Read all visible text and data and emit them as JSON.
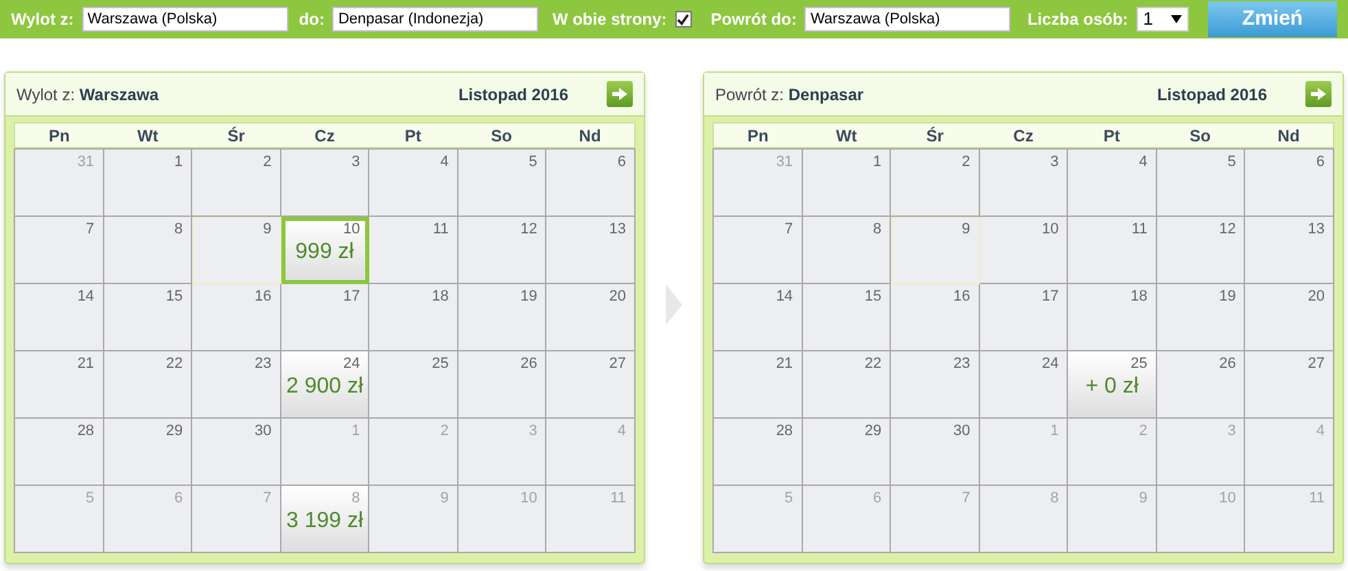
{
  "search_bar": {
    "from_label": "Wylot z:",
    "from_value": "Warszawa (Polska)",
    "to_label": "do:",
    "to_value": "Denpasar (Indonezja)",
    "round_trip_label": "W obie strony:",
    "round_trip_checked": true,
    "return_label": "Powrót do:",
    "return_value": "Warszawa (Polska)",
    "persons_label": "Liczba osób:",
    "persons_value": "1",
    "submit": "Zmień"
  },
  "calendars": [
    {
      "label": "Wylot z:",
      "city": "Warszawa",
      "month": "Listopad 2016",
      "weekdays": [
        "Pn",
        "Wt",
        "Śr",
        "Cz",
        "Pt",
        "So",
        "Nd"
      ],
      "weeks": [
        [
          {
            "day": "31",
            "other_month": true,
            "selected": false,
            "highlighted": false
          },
          {
            "day": "1",
            "other_month": false,
            "selected": false,
            "highlighted": false
          },
          {
            "day": "2",
            "other_month": false,
            "selected": false,
            "highlighted": false
          },
          {
            "day": "3",
            "other_month": false,
            "selected": false,
            "highlighted": false
          },
          {
            "day": "4",
            "other_month": false,
            "selected": false,
            "highlighted": false
          },
          {
            "day": "5",
            "other_month": false,
            "selected": false,
            "highlighted": false
          },
          {
            "day": "6",
            "other_month": false,
            "selected": false,
            "highlighted": false
          }
        ],
        [
          {
            "day": "7",
            "other_month": false,
            "selected": false,
            "highlighted": false
          },
          {
            "day": "8",
            "other_month": false,
            "selected": false,
            "highlighted": false
          },
          {
            "day": "9",
            "other_month": false,
            "selected": false,
            "highlighted": true
          },
          {
            "day": "10",
            "other_month": false,
            "selected": true,
            "highlighted": false,
            "price": "999 zł"
          },
          {
            "day": "11",
            "other_month": false,
            "selected": false,
            "highlighted": false
          },
          {
            "day": "12",
            "other_month": false,
            "selected": false,
            "highlighted": false
          },
          {
            "day": "13",
            "other_month": false,
            "selected": false,
            "highlighted": false
          }
        ],
        [
          {
            "day": "14",
            "other_month": false,
            "selected": false,
            "highlighted": false
          },
          {
            "day": "15",
            "other_month": false,
            "selected": false,
            "highlighted": false
          },
          {
            "day": "16",
            "other_month": false,
            "selected": false,
            "highlighted": false
          },
          {
            "day": "17",
            "other_month": false,
            "selected": false,
            "highlighted": false
          },
          {
            "day": "18",
            "other_month": false,
            "selected": false,
            "highlighted": false
          },
          {
            "day": "19",
            "other_month": false,
            "selected": false,
            "highlighted": false
          },
          {
            "day": "20",
            "other_month": false,
            "selected": false,
            "highlighted": false
          }
        ],
        [
          {
            "day": "21",
            "other_month": false,
            "selected": false,
            "highlighted": false
          },
          {
            "day": "22",
            "other_month": false,
            "selected": false,
            "highlighted": false
          },
          {
            "day": "23",
            "other_month": false,
            "selected": false,
            "highlighted": false
          },
          {
            "day": "24",
            "other_month": false,
            "selected": false,
            "highlighted": false,
            "price": "2 900 zł"
          },
          {
            "day": "25",
            "other_month": false,
            "selected": false,
            "highlighted": false
          },
          {
            "day": "26",
            "other_month": false,
            "selected": false,
            "highlighted": false
          },
          {
            "day": "27",
            "other_month": false,
            "selected": false,
            "highlighted": false
          }
        ],
        [
          {
            "day": "28",
            "other_month": false,
            "selected": false,
            "highlighted": false
          },
          {
            "day": "29",
            "other_month": false,
            "selected": false,
            "highlighted": false
          },
          {
            "day": "30",
            "other_month": false,
            "selected": false,
            "highlighted": false
          },
          {
            "day": "1",
            "other_month": true,
            "selected": false,
            "highlighted": false
          },
          {
            "day": "2",
            "other_month": true,
            "selected": false,
            "highlighted": false
          },
          {
            "day": "3",
            "other_month": true,
            "selected": false,
            "highlighted": false
          },
          {
            "day": "4",
            "other_month": true,
            "selected": false,
            "highlighted": false
          }
        ],
        [
          {
            "day": "5",
            "other_month": true,
            "selected": false,
            "highlighted": false
          },
          {
            "day": "6",
            "other_month": true,
            "selected": false,
            "highlighted": false
          },
          {
            "day": "7",
            "other_month": true,
            "selected": false,
            "highlighted": false
          },
          {
            "day": "8",
            "other_month": true,
            "selected": false,
            "highlighted": false,
            "price": "3 199 zł"
          },
          {
            "day": "9",
            "other_month": true,
            "selected": false,
            "highlighted": false
          },
          {
            "day": "10",
            "other_month": true,
            "selected": false,
            "highlighted": false
          },
          {
            "day": "11",
            "other_month": true,
            "selected": false,
            "highlighted": false
          }
        ]
      ]
    },
    {
      "label": "Powrót z:",
      "city": "Denpasar",
      "month": "Listopad 2016",
      "weekdays": [
        "Pn",
        "Wt",
        "Śr",
        "Cz",
        "Pt",
        "So",
        "Nd"
      ],
      "weeks": [
        [
          {
            "day": "31",
            "other_month": true,
            "selected": false,
            "highlighted": false
          },
          {
            "day": "1",
            "other_month": false,
            "selected": false,
            "highlighted": false
          },
          {
            "day": "2",
            "other_month": false,
            "selected": false,
            "highlighted": false
          },
          {
            "day": "3",
            "other_month": false,
            "selected": false,
            "highlighted": false
          },
          {
            "day": "4",
            "other_month": false,
            "selected": false,
            "highlighted": false
          },
          {
            "day": "5",
            "other_month": false,
            "selected": false,
            "highlighted": false
          },
          {
            "day": "6",
            "other_month": false,
            "selected": false,
            "highlighted": false
          }
        ],
        [
          {
            "day": "7",
            "other_month": false,
            "selected": false,
            "highlighted": false
          },
          {
            "day": "8",
            "other_month": false,
            "selected": false,
            "highlighted": false
          },
          {
            "day": "9",
            "other_month": false,
            "selected": false,
            "highlighted": true
          },
          {
            "day": "10",
            "other_month": false,
            "selected": false,
            "highlighted": false
          },
          {
            "day": "11",
            "other_month": false,
            "selected": false,
            "highlighted": false
          },
          {
            "day": "12",
            "other_month": false,
            "selected": false,
            "highlighted": false
          },
          {
            "day": "13",
            "other_month": false,
            "selected": false,
            "highlighted": false
          }
        ],
        [
          {
            "day": "14",
            "other_month": false,
            "selected": false,
            "highlighted": false
          },
          {
            "day": "15",
            "other_month": false,
            "selected": false,
            "highlighted": false
          },
          {
            "day": "16",
            "other_month": false,
            "selected": false,
            "highlighted": false
          },
          {
            "day": "17",
            "other_month": false,
            "selected": false,
            "highlighted": false
          },
          {
            "day": "18",
            "other_month": false,
            "selected": false,
            "highlighted": false
          },
          {
            "day": "19",
            "other_month": false,
            "selected": false,
            "highlighted": false
          },
          {
            "day": "20",
            "other_month": false,
            "selected": false,
            "highlighted": false
          }
        ],
        [
          {
            "day": "21",
            "other_month": false,
            "selected": false,
            "highlighted": false
          },
          {
            "day": "22",
            "other_month": false,
            "selected": false,
            "highlighted": false
          },
          {
            "day": "23",
            "other_month": false,
            "selected": false,
            "highlighted": false
          },
          {
            "day": "24",
            "other_month": false,
            "selected": false,
            "highlighted": false
          },
          {
            "day": "25",
            "other_month": false,
            "selected": false,
            "highlighted": false,
            "price": "+ 0 zł"
          },
          {
            "day": "26",
            "other_month": false,
            "selected": false,
            "highlighted": false
          },
          {
            "day": "27",
            "other_month": false,
            "selected": false,
            "highlighted": false
          }
        ],
        [
          {
            "day": "28",
            "other_month": false,
            "selected": false,
            "highlighted": false
          },
          {
            "day": "29",
            "other_month": false,
            "selected": false,
            "highlighted": false
          },
          {
            "day": "30",
            "other_month": false,
            "selected": false,
            "highlighted": false
          },
          {
            "day": "1",
            "other_month": true,
            "selected": false,
            "highlighted": false
          },
          {
            "day": "2",
            "other_month": true,
            "selected": false,
            "highlighted": false
          },
          {
            "day": "3",
            "other_month": true,
            "selected": false,
            "highlighted": false
          },
          {
            "day": "4",
            "other_month": true,
            "selected": false,
            "highlighted": false
          }
        ],
        [
          {
            "day": "5",
            "other_month": true,
            "selected": false,
            "highlighted": false
          },
          {
            "day": "6",
            "other_month": true,
            "selected": false,
            "highlighted": false
          },
          {
            "day": "7",
            "other_month": true,
            "selected": false,
            "highlighted": false
          },
          {
            "day": "8",
            "other_month": true,
            "selected": false,
            "highlighted": false
          },
          {
            "day": "9",
            "other_month": true,
            "selected": false,
            "highlighted": false
          },
          {
            "day": "10",
            "other_month": true,
            "selected": false,
            "highlighted": false
          },
          {
            "day": "11",
            "other_month": true,
            "selected": false,
            "highlighted": false
          }
        ]
      ]
    }
  ]
}
